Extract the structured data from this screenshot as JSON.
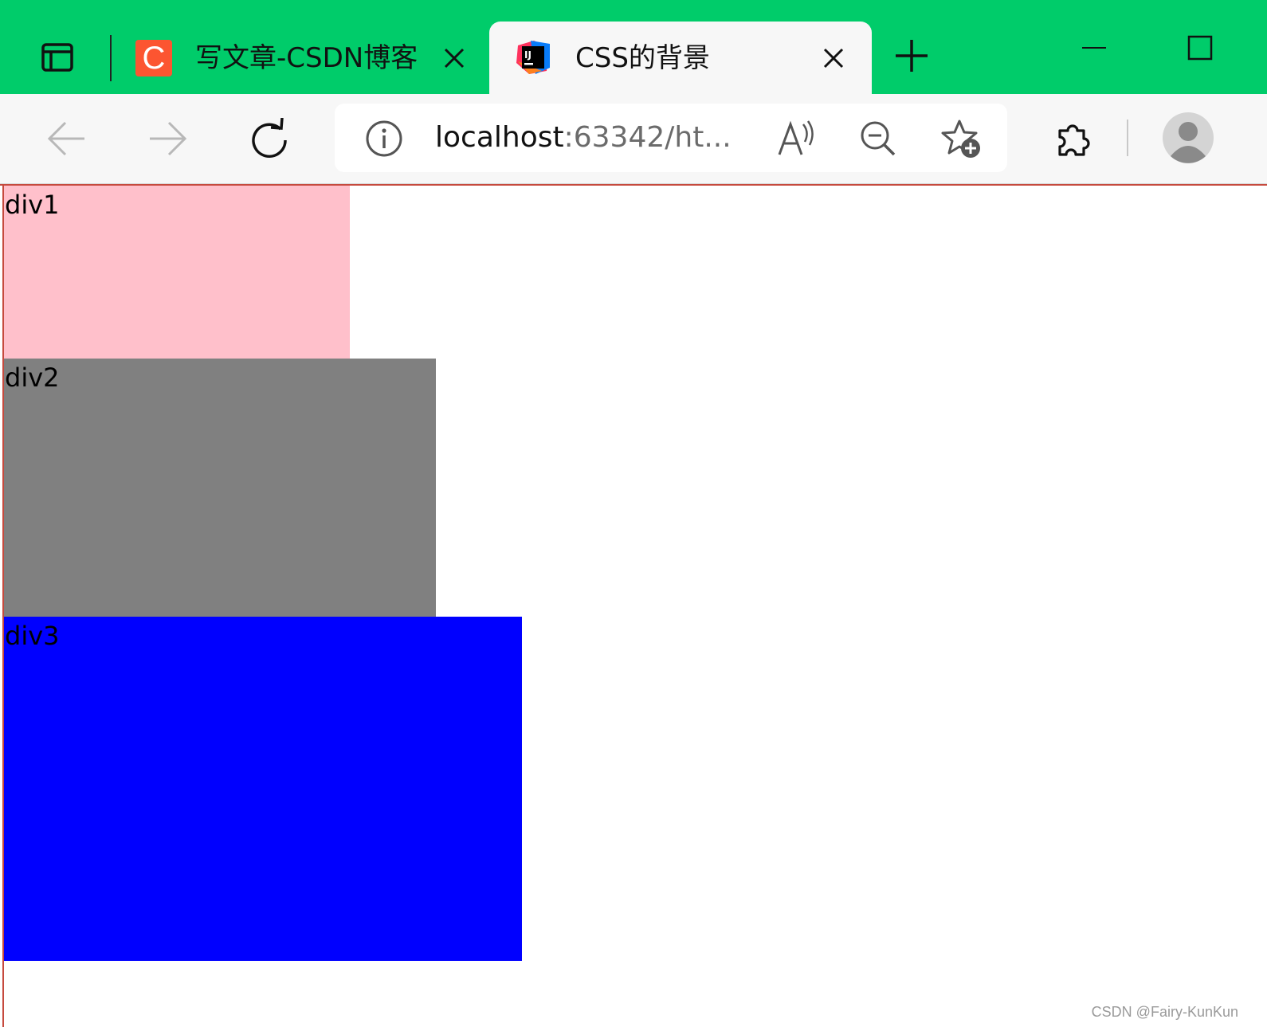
{
  "browser": {
    "accent_color": "#00cc6a",
    "tabs": [
      {
        "title": "写文章-CSDN博客",
        "favicon": "csdn-icon",
        "favicon_letter": "C",
        "active": false
      },
      {
        "title": "CSS的背景",
        "favicon": "intellij-icon",
        "active": true
      }
    ],
    "address": {
      "host": "localhost",
      "rest": ":63342/ht..."
    },
    "toolbar_icons": [
      "back-icon",
      "forward-icon",
      "refresh-icon",
      "info-icon",
      "read-aloud-icon",
      "zoom-out-icon",
      "add-favorite-icon",
      "extensions-icon",
      "profile-icon"
    ]
  },
  "page": {
    "divs": [
      {
        "label": "div1",
        "background": "#ffc0cb"
      },
      {
        "label": "div2",
        "background": "#808080"
      },
      {
        "label": "div3",
        "background": "#0000ff"
      }
    ],
    "watermark": "CSDN @Fairy-KunKun"
  }
}
